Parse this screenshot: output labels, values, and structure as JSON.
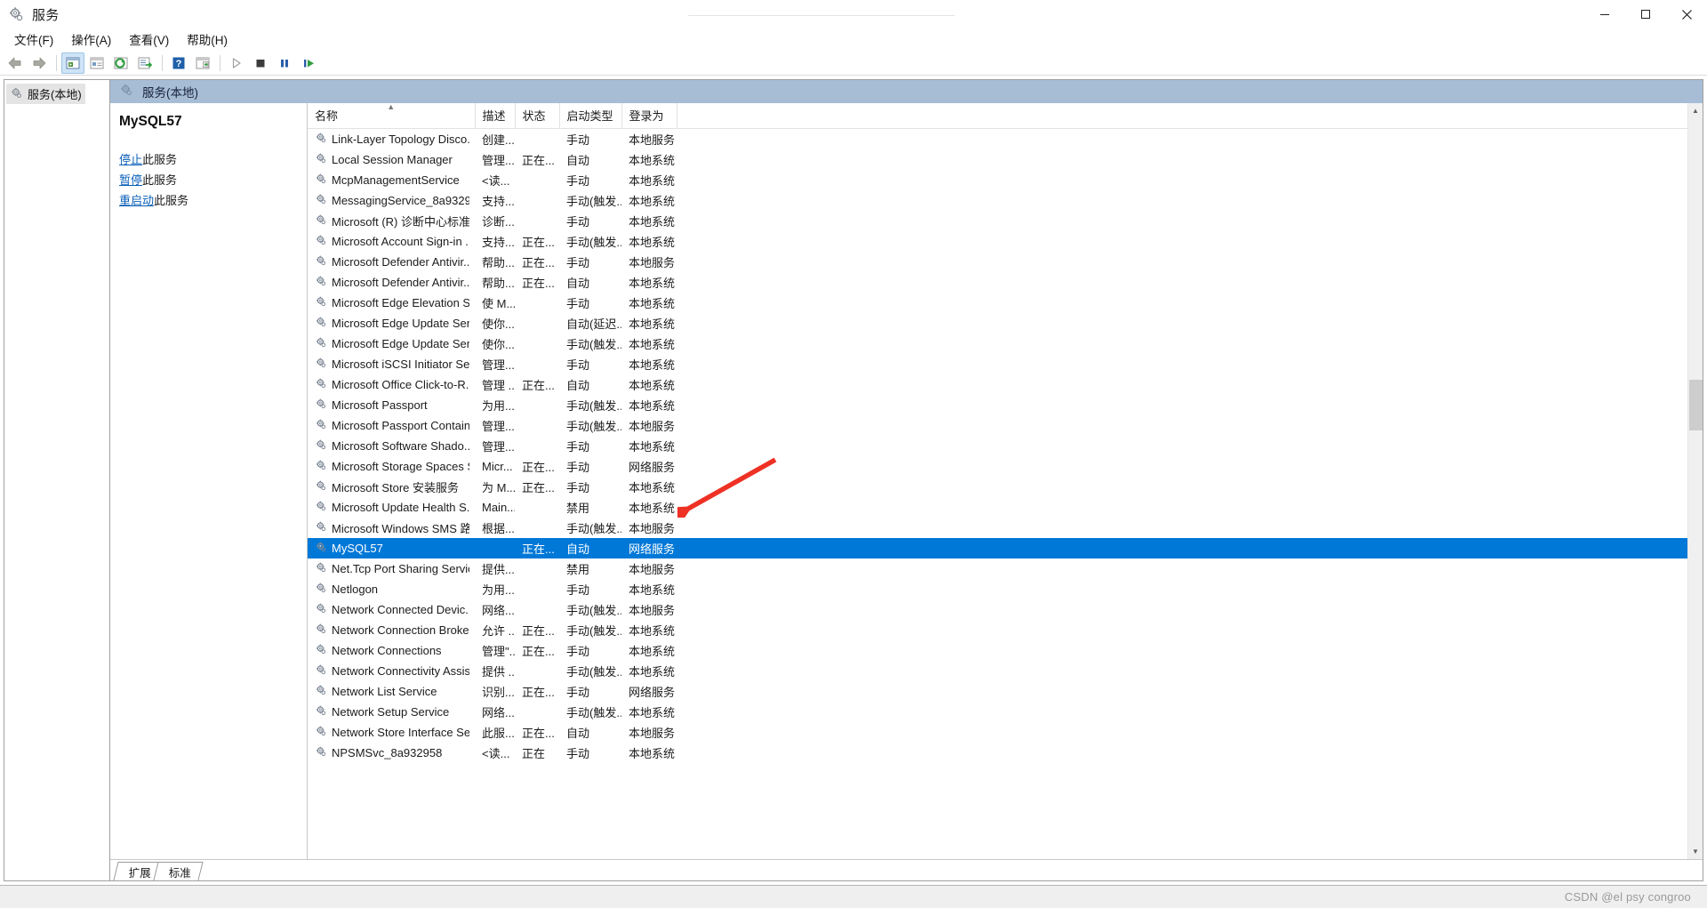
{
  "window": {
    "title": "服务",
    "icon": "services-gear-icon",
    "controls": {
      "minimize": "最小化",
      "maximize": "最大化",
      "close": "关闭"
    }
  },
  "menu": {
    "items": [
      {
        "label": "文件(F)",
        "name": "menu-file"
      },
      {
        "label": "操作(A)",
        "name": "menu-action"
      },
      {
        "label": "查看(V)",
        "name": "menu-view"
      },
      {
        "label": "帮助(H)",
        "name": "menu-help"
      }
    ]
  },
  "toolbar": {
    "buttons": [
      {
        "name": "back-button",
        "icon": "arrow-left-icon",
        "active": false
      },
      {
        "name": "forward-button",
        "icon": "arrow-right-icon",
        "active": false
      },
      {
        "name": "show-hide-console-tree-button",
        "icon": "console-tree-icon",
        "active": true
      },
      {
        "name": "properties-button",
        "icon": "properties-icon",
        "active": false
      },
      {
        "name": "refresh-button",
        "icon": "refresh-icon",
        "active": false
      },
      {
        "name": "export-list-button",
        "icon": "export-list-icon",
        "active": false
      },
      {
        "name": "help-button",
        "icon": "help-question-icon",
        "active": false
      },
      {
        "name": "show-action-pane-button",
        "icon": "action-pane-icon",
        "active": false
      },
      {
        "name": "start-service-button",
        "icon": "play-icon",
        "active": false
      },
      {
        "name": "stop-service-button",
        "icon": "stop-icon",
        "active": false
      },
      {
        "name": "pause-service-button",
        "icon": "pause-icon",
        "active": false
      },
      {
        "name": "restart-service-button",
        "icon": "restart-icon",
        "active": false
      }
    ]
  },
  "tree": {
    "root": {
      "label": "服务(本地)",
      "icon": "services-gear-icon"
    }
  },
  "pane": {
    "header": "服务(本地)"
  },
  "details": {
    "service_name": "MySQL57",
    "links": [
      {
        "link_text": "停止",
        "rest_text": "此服务",
        "name": "stop-this-service-link"
      },
      {
        "link_text": "暂停",
        "rest_text": "此服务",
        "name": "pause-this-service-link"
      },
      {
        "link_text": "重启动",
        "rest_text": "此服务",
        "name": "restart-this-service-link"
      }
    ]
  },
  "list": {
    "columns": [
      {
        "label": "名称",
        "key": "name",
        "sorted": "asc"
      },
      {
        "label": "描述",
        "key": "desc"
      },
      {
        "label": "状态",
        "key": "state"
      },
      {
        "label": "启动类型",
        "key": "startup"
      },
      {
        "label": "登录为",
        "key": "logon"
      }
    ],
    "rows": [
      {
        "name": "Link-Layer Topology Disco...",
        "desc": "创建...",
        "state": "",
        "startup": "手动",
        "logon": "本地服务",
        "selected": false
      },
      {
        "name": "Local Session Manager",
        "desc": "管理...",
        "state": "正在...",
        "startup": "自动",
        "logon": "本地系统",
        "selected": false
      },
      {
        "name": "McpManagementService",
        "desc": "<读...",
        "state": "",
        "startup": "手动",
        "logon": "本地系统",
        "selected": false
      },
      {
        "name": "MessagingService_8a9329...",
        "desc": "支持...",
        "state": "",
        "startup": "手动(触发...",
        "logon": "本地系统",
        "selected": false
      },
      {
        "name": "Microsoft (R) 诊断中心标准...",
        "desc": "诊断...",
        "state": "",
        "startup": "手动",
        "logon": "本地系统",
        "selected": false
      },
      {
        "name": "Microsoft Account Sign-in ...",
        "desc": "支持...",
        "state": "正在...",
        "startup": "手动(触发...",
        "logon": "本地系统",
        "selected": false
      },
      {
        "name": "Microsoft Defender Antivir...",
        "desc": "帮助...",
        "state": "正在...",
        "startup": "手动",
        "logon": "本地服务",
        "selected": false
      },
      {
        "name": "Microsoft Defender Antivir...",
        "desc": "帮助...",
        "state": "正在...",
        "startup": "自动",
        "logon": "本地系统",
        "selected": false
      },
      {
        "name": "Microsoft Edge Elevation S...",
        "desc": "使 M...",
        "state": "",
        "startup": "手动",
        "logon": "本地系统",
        "selected": false
      },
      {
        "name": "Microsoft Edge Update Ser...",
        "desc": "使你...",
        "state": "",
        "startup": "自动(延迟...",
        "logon": "本地系统",
        "selected": false
      },
      {
        "name": "Microsoft Edge Update Ser...",
        "desc": "使你...",
        "state": "",
        "startup": "手动(触发...",
        "logon": "本地系统",
        "selected": false
      },
      {
        "name": "Microsoft iSCSI Initiator Ser...",
        "desc": "管理...",
        "state": "",
        "startup": "手动",
        "logon": "本地系统",
        "selected": false
      },
      {
        "name": "Microsoft Office Click-to-R...",
        "desc": "管理 ...",
        "state": "正在...",
        "startup": "自动",
        "logon": "本地系统",
        "selected": false
      },
      {
        "name": "Microsoft Passport",
        "desc": "为用...",
        "state": "",
        "startup": "手动(触发...",
        "logon": "本地系统",
        "selected": false
      },
      {
        "name": "Microsoft Passport Container",
        "desc": "管理...",
        "state": "",
        "startup": "手动(触发...",
        "logon": "本地服务",
        "selected": false
      },
      {
        "name": "Microsoft Software Shado...",
        "desc": "管理...",
        "state": "",
        "startup": "手动",
        "logon": "本地系统",
        "selected": false
      },
      {
        "name": "Microsoft Storage Spaces S...",
        "desc": "Micr...",
        "state": "正在...",
        "startup": "手动",
        "logon": "网络服务",
        "selected": false
      },
      {
        "name": "Microsoft Store 安装服务",
        "desc": "为 M...",
        "state": "正在...",
        "startup": "手动",
        "logon": "本地系统",
        "selected": false
      },
      {
        "name": "Microsoft Update Health S...",
        "desc": "Main...",
        "state": "",
        "startup": "禁用",
        "logon": "本地系统",
        "selected": false
      },
      {
        "name": "Microsoft Windows SMS 路...",
        "desc": "根据...",
        "state": "",
        "startup": "手动(触发...",
        "logon": "本地服务",
        "selected": false
      },
      {
        "name": "MySQL57",
        "desc": "",
        "state": "正在...",
        "startup": "自动",
        "logon": "网络服务",
        "selected": true
      },
      {
        "name": "Net.Tcp Port Sharing Service",
        "desc": "提供...",
        "state": "",
        "startup": "禁用",
        "logon": "本地服务",
        "selected": false
      },
      {
        "name": "Netlogon",
        "desc": "为用...",
        "state": "",
        "startup": "手动",
        "logon": "本地系统",
        "selected": false
      },
      {
        "name": "Network Connected Devic...",
        "desc": "网络...",
        "state": "",
        "startup": "手动(触发...",
        "logon": "本地服务",
        "selected": false
      },
      {
        "name": "Network Connection Broker",
        "desc": "允许 ...",
        "state": "正在...",
        "startup": "手动(触发...",
        "logon": "本地系统",
        "selected": false
      },
      {
        "name": "Network Connections",
        "desc": "管理\"...",
        "state": "正在...",
        "startup": "手动",
        "logon": "本地系统",
        "selected": false
      },
      {
        "name": "Network Connectivity Assis...",
        "desc": "提供 ...",
        "state": "",
        "startup": "手动(触发...",
        "logon": "本地系统",
        "selected": false
      },
      {
        "name": "Network List Service",
        "desc": "识别...",
        "state": "正在...",
        "startup": "手动",
        "logon": "网络服务",
        "selected": false
      },
      {
        "name": "Network Setup Service",
        "desc": "网络...",
        "state": "",
        "startup": "手动(触发...",
        "logon": "本地系统",
        "selected": false
      },
      {
        "name": "Network Store Interface Se...",
        "desc": "此服...",
        "state": "正在...",
        "startup": "自动",
        "logon": "本地服务",
        "selected": false
      },
      {
        "name": "NPSMSvc_8a932958",
        "desc": "<读...",
        "state": "正在",
        "startup": "手动",
        "logon": "本地系统",
        "selected": false
      }
    ]
  },
  "tabs": [
    {
      "label": "扩展",
      "name": "tab-extended",
      "selected": false
    },
    {
      "label": "标准",
      "name": "tab-standard",
      "selected": true
    }
  ],
  "statusbar": {
    "watermark": "CSDN @el psy congroo"
  },
  "colors": {
    "selection": "#0078d7",
    "pane_header": "#a7bdd6",
    "link": "#0a5fb8",
    "annotation_arrow": "#ee3124"
  }
}
